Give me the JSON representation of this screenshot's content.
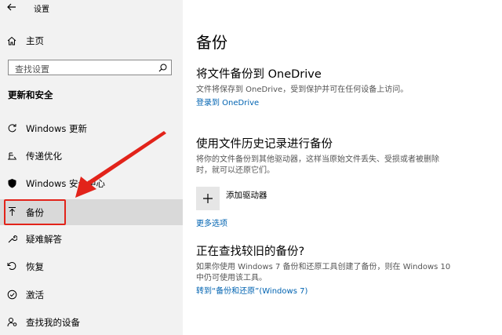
{
  "window": {
    "title": "设置"
  },
  "sidebar": {
    "home_label": "主页",
    "search_placeholder": "查找设置",
    "section_title": "更新和安全",
    "items": [
      {
        "label": "Windows 更新",
        "icon": "refresh-icon"
      },
      {
        "label": "传递优化",
        "icon": "delivery-optimization-icon"
      },
      {
        "label": "Windows 安全中心",
        "icon": "shield-icon"
      },
      {
        "label": "备份",
        "icon": "backup-arrow-icon",
        "selected": true
      },
      {
        "label": "疑难解答",
        "icon": "wrench-icon"
      },
      {
        "label": "恢复",
        "icon": "recovery-icon"
      },
      {
        "label": "激活",
        "icon": "check-circle-icon"
      },
      {
        "label": "查找我的设备",
        "icon": "person-location-icon"
      }
    ]
  },
  "main": {
    "title": "备份",
    "onedrive": {
      "heading": "将文件备份到 OneDrive",
      "description": "文件将保存到 OneDrive，受到保护并可在任何设备上访问。",
      "link": "登录到 OneDrive"
    },
    "file_history": {
      "heading": "使用文件历史记录进行备份",
      "description_line1": "将你的文件备份到其他驱动器，这样当原始文件丢失、受损或者被删除",
      "description_line2": "时，就可以还原它们。",
      "add_drive_label": "添加驱动器",
      "more_options_link": "更多选项"
    },
    "older_backup": {
      "heading": "正在查找较旧的备份?",
      "description_line1": "如果你使用 Windows 7 备份和还原工具创建了备份，则在 Windows 10",
      "description_line2": "中仍可使用该工具。",
      "link": "转到“备份和还原”(Windows 7)"
    }
  },
  "colors": {
    "accent_link": "#0063b1",
    "annotation_red": "#e2231a",
    "sidebar_bg": "#f2f2f2"
  }
}
